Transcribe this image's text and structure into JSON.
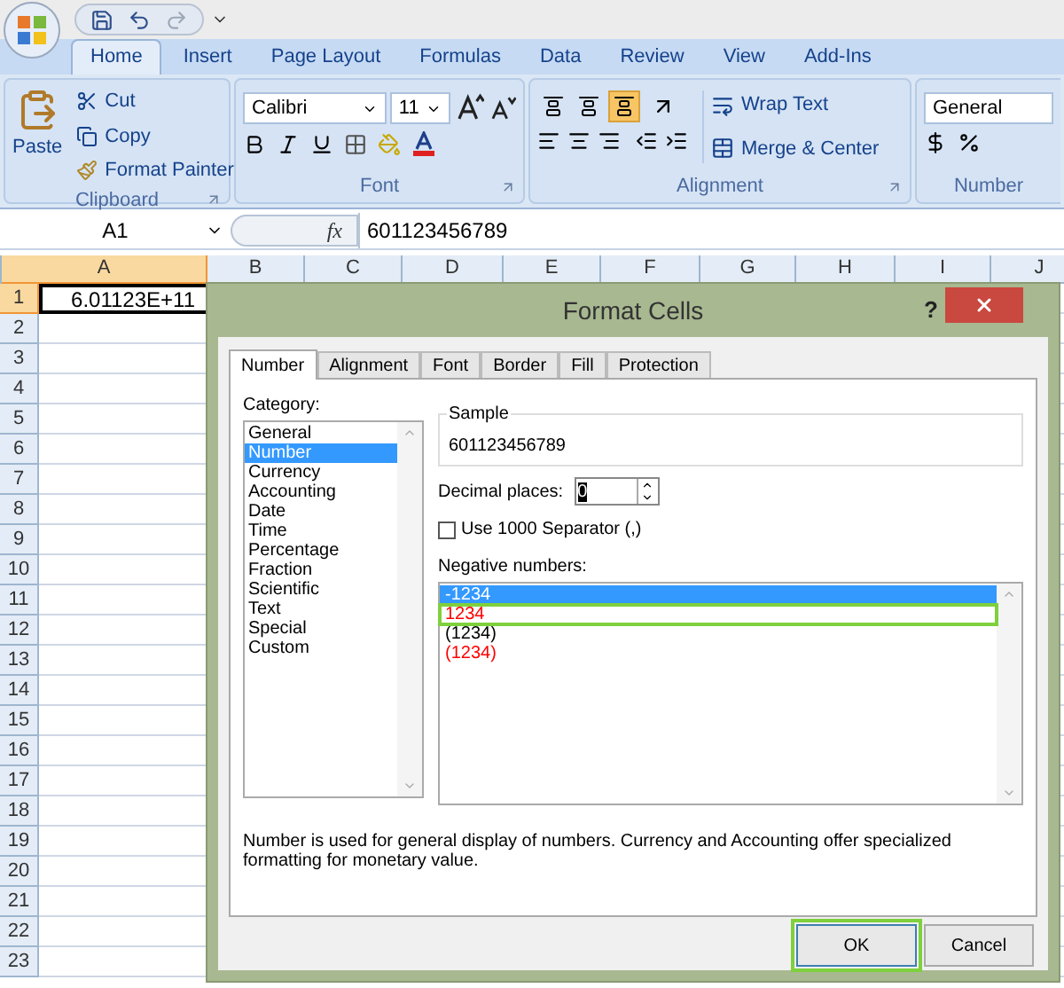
{
  "ribbon_tabs": [
    {
      "label": "Home",
      "selected": true
    },
    {
      "label": "Insert",
      "selected": false
    },
    {
      "label": "Page Layout",
      "selected": false
    },
    {
      "label": "Formulas",
      "selected": false
    },
    {
      "label": "Data",
      "selected": false
    },
    {
      "label": "Review",
      "selected": false
    },
    {
      "label": "View",
      "selected": false
    },
    {
      "label": "Add-Ins",
      "selected": false
    }
  ],
  "clipboard": {
    "title": "Clipboard",
    "paste": "Paste",
    "cut": "Cut",
    "copy": "Copy",
    "format_painter": "Format Painter"
  },
  "font": {
    "title": "Font",
    "font_name": "Calibri",
    "font_size": "11"
  },
  "alignment": {
    "title": "Alignment",
    "wrap_text": "Wrap Text",
    "merge": "Merge & Center",
    "vertical_align": [
      {
        "selected": false
      },
      {
        "selected": false
      },
      {
        "selected": true
      }
    ]
  },
  "number": {
    "title": "Number",
    "format": "General"
  },
  "formula_bar": {
    "name_box": "A1",
    "function_label": "fx",
    "value": "601123456789"
  },
  "sheet": {
    "columns": [
      {
        "label": "A",
        "selected": true
      },
      {
        "label": "B",
        "selected": false
      },
      {
        "label": "C",
        "selected": false
      },
      {
        "label": "D",
        "selected": false
      },
      {
        "label": "E",
        "selected": false
      },
      {
        "label": "F",
        "selected": false
      },
      {
        "label": "G",
        "selected": false
      },
      {
        "label": "H",
        "selected": false
      },
      {
        "label": "I",
        "selected": false
      },
      {
        "label": "J",
        "selected": false
      }
    ],
    "rows": [
      {
        "label": "1",
        "selected": true
      },
      {
        "label": "2",
        "selected": false
      },
      {
        "label": "3",
        "selected": false
      },
      {
        "label": "4",
        "selected": false
      },
      {
        "label": "5",
        "selected": false
      },
      {
        "label": "6",
        "selected": false
      },
      {
        "label": "7",
        "selected": false
      },
      {
        "label": "8",
        "selected": false
      },
      {
        "label": "9",
        "selected": false
      },
      {
        "label": "10",
        "selected": false
      },
      {
        "label": "11",
        "selected": false
      },
      {
        "label": "12",
        "selected": false
      },
      {
        "label": "13",
        "selected": false
      },
      {
        "label": "14",
        "selected": false
      },
      {
        "label": "15",
        "selected": false
      },
      {
        "label": "16",
        "selected": false
      },
      {
        "label": "17",
        "selected": false
      },
      {
        "label": "18",
        "selected": false
      },
      {
        "label": "19",
        "selected": false
      },
      {
        "label": "20",
        "selected": false
      },
      {
        "label": "21",
        "selected": false
      },
      {
        "label": "22",
        "selected": false
      },
      {
        "label": "23",
        "selected": false
      }
    ],
    "active_cell": "6.01123E+11"
  },
  "dialog": {
    "title": "Format Cells",
    "help": "?",
    "tabs": [
      {
        "label": "Number",
        "selected": true
      },
      {
        "label": "Alignment",
        "selected": false
      },
      {
        "label": "Font",
        "selected": false
      },
      {
        "label": "Border",
        "selected": false
      },
      {
        "label": "Fill",
        "selected": false
      },
      {
        "label": "Protection",
        "selected": false
      }
    ],
    "category_label": "Category:",
    "categories": [
      {
        "label": "General",
        "selected": false
      },
      {
        "label": "Number",
        "selected": true
      },
      {
        "label": "Currency",
        "selected": false
      },
      {
        "label": "Accounting",
        "selected": false
      },
      {
        "label": "Date",
        "selected": false
      },
      {
        "label": "Time",
        "selected": false
      },
      {
        "label": "Percentage",
        "selected": false
      },
      {
        "label": "Fraction",
        "selected": false
      },
      {
        "label": "Scientific",
        "selected": false
      },
      {
        "label": "Text",
        "selected": false
      },
      {
        "label": "Special",
        "selected": false
      },
      {
        "label": "Custom",
        "selected": false
      }
    ],
    "sample_label": "Sample",
    "sample": "601123456789",
    "decimal_label": "Decimal places:",
    "decimal_value": "0",
    "separator": {
      "label": "Use 1000 Separator (,)",
      "checked": false
    },
    "negative_label": "Negative numbers:",
    "negative_numbers": [
      {
        "text": "-1234",
        "selected": true,
        "highlighted": false
      },
      {
        "text": "1234",
        "color": "#ff0000",
        "selected": false,
        "highlighted": true
      },
      {
        "text": "(1234)",
        "color": "#000000",
        "selected": false,
        "highlighted": false
      },
      {
        "text": "(1234)",
        "color": "#ff0000",
        "selected": false,
        "highlighted": false
      }
    ],
    "description": "Number is used for general display of numbers.  Currency and Accounting offer specialized formatting for monetary value.",
    "buttons": [
      {
        "label": "OK",
        "highlighted": true
      },
      {
        "label": "Cancel",
        "highlighted": false
      }
    ]
  }
}
